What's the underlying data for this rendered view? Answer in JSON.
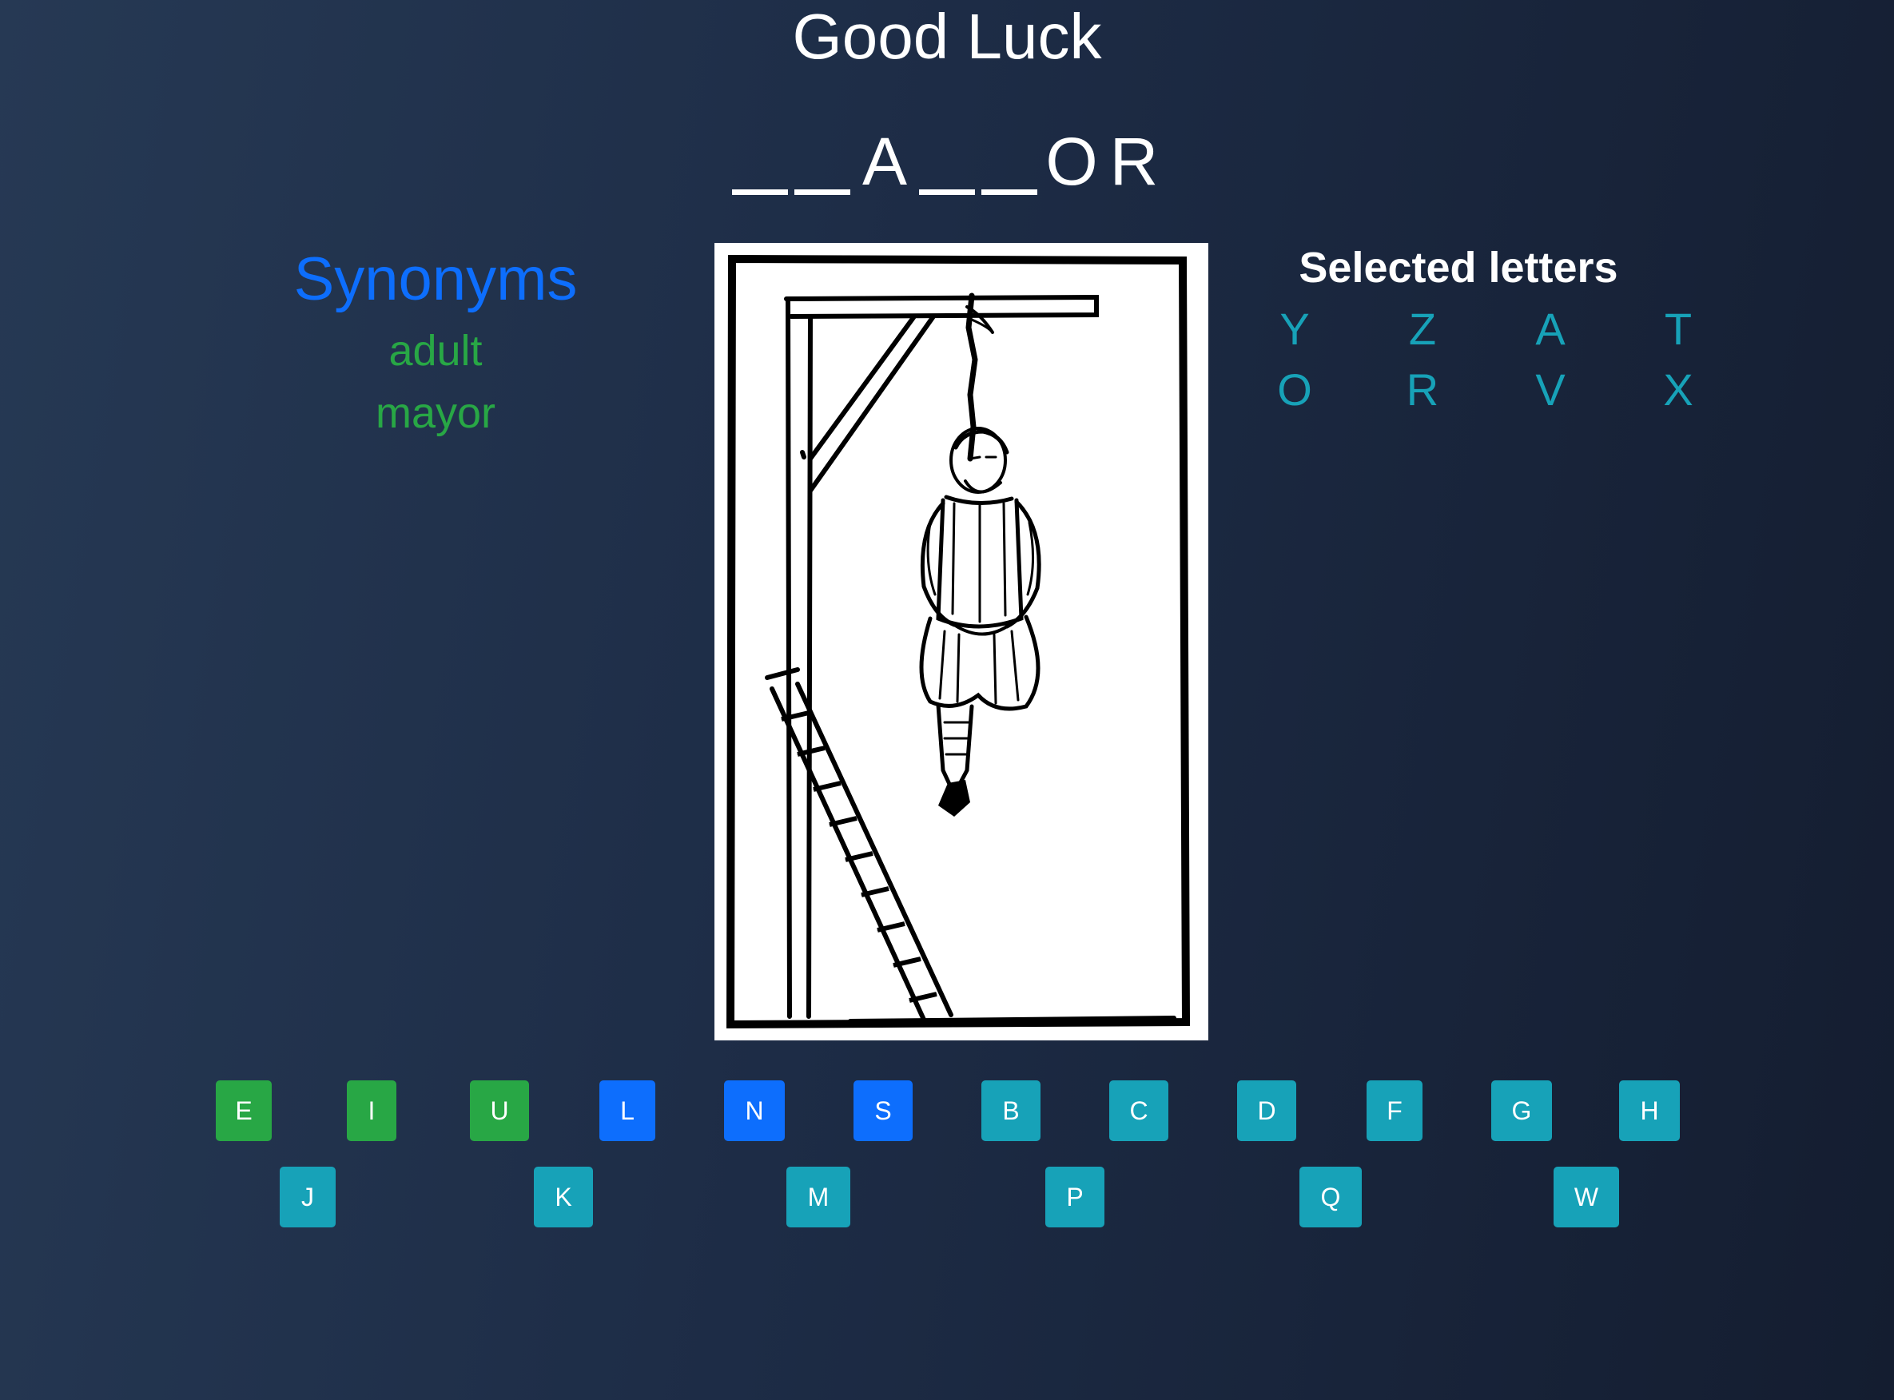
{
  "header": {
    "title": "Good Luck"
  },
  "word": {
    "slots": [
      "",
      "",
      "A",
      "",
      "",
      "O",
      "R"
    ]
  },
  "synonyms": {
    "title": "Synonyms",
    "items": [
      "adult",
      "mayor"
    ]
  },
  "selected": {
    "title": "Selected letters",
    "letters": [
      "Y",
      "Z",
      "A",
      "T",
      "O",
      "R",
      "V",
      "X"
    ]
  },
  "keyboard": {
    "row1": [
      {
        "letter": "E",
        "state": "correct"
      },
      {
        "letter": "I",
        "state": "correct"
      },
      {
        "letter": "U",
        "state": "correct"
      },
      {
        "letter": "L",
        "state": "hint"
      },
      {
        "letter": "N",
        "state": "hint"
      },
      {
        "letter": "S",
        "state": "hint"
      },
      {
        "letter": "B",
        "state": "available"
      },
      {
        "letter": "C",
        "state": "available"
      },
      {
        "letter": "D",
        "state": "available"
      },
      {
        "letter": "F",
        "state": "available"
      },
      {
        "letter": "G",
        "state": "available"
      },
      {
        "letter": "H",
        "state": "available"
      }
    ],
    "row2": [
      {
        "letter": "J",
        "state": "available"
      },
      {
        "letter": "K",
        "state": "available"
      },
      {
        "letter": "M",
        "state": "available"
      },
      {
        "letter": "P",
        "state": "available"
      },
      {
        "letter": "Q",
        "state": "available"
      },
      {
        "letter": "W",
        "state": "available"
      }
    ]
  },
  "colors": {
    "background": "#1d2c46",
    "primary": "#0d6efd",
    "success": "#28a745",
    "info": "#17a2b8"
  },
  "gallows_image": {
    "description_icon": "hanged-man-gallows-illustration"
  }
}
